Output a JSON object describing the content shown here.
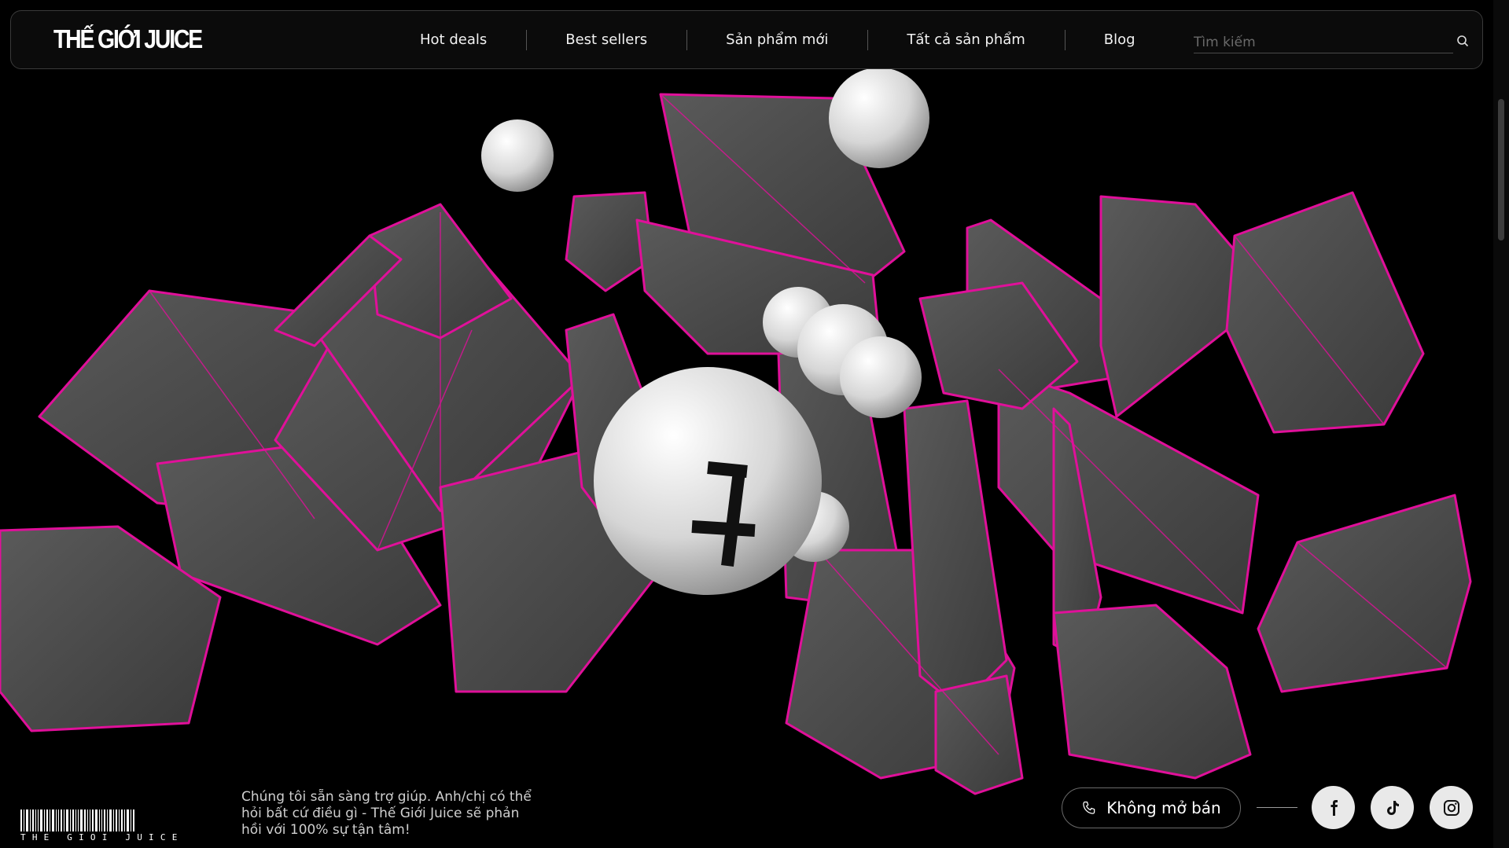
{
  "brand": {
    "logo_text": "THẾ GIỚI JUICE"
  },
  "nav": {
    "items": [
      {
        "label": "Hot deals"
      },
      {
        "label": "Best sellers"
      },
      {
        "label": "Sản phẩm mới"
      },
      {
        "label": "Tất cả sản phẩm"
      },
      {
        "label": "Blog"
      }
    ]
  },
  "search": {
    "placeholder": "Tìm kiếm",
    "value": "",
    "icon": "search-icon"
  },
  "hero": {
    "accent_color": "#e0109a",
    "device_color": "#4a4a4a",
    "sphere_color": "#d8d8d8"
  },
  "footer": {
    "barcode_text": "THE GIOI JUICE",
    "support_text": "Chúng tôi sẵn sàng trợ giúp. Anh/chị có thể hỏi bất cứ điều gì - Thế Giới Juice sẽ phản hồi với 100% sự tận tâm!",
    "status_label": "Không mở bán",
    "status_icon": "phone-icon",
    "socials": [
      {
        "icon": "facebook-icon"
      },
      {
        "icon": "tiktok-icon"
      },
      {
        "icon": "instagram-icon"
      }
    ]
  }
}
